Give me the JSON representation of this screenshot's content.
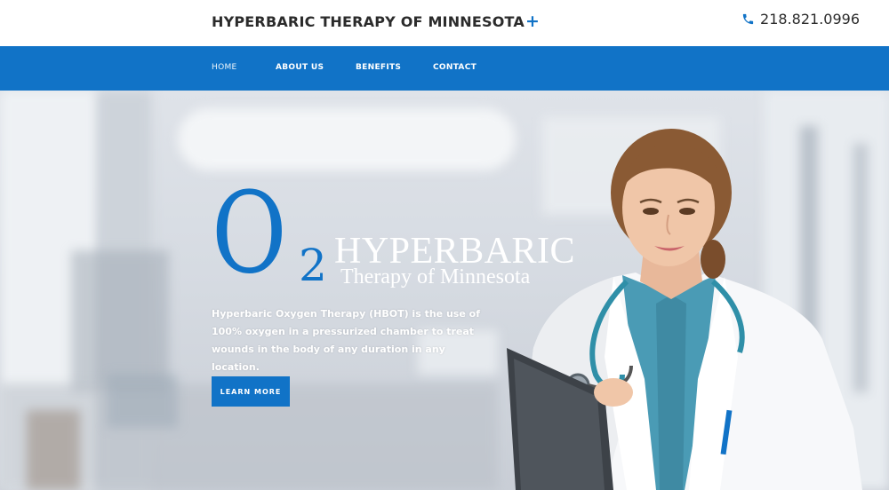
{
  "header": {
    "site_title": "HYPERBARIC THERAPY OF MINNESOTA",
    "title_plus": "+",
    "phone": "218.821.0996",
    "phone_icon": "phone-icon"
  },
  "nav": {
    "items": [
      {
        "label": "HOME"
      },
      {
        "label": "ABOUT US"
      },
      {
        "label": "BENEFITS"
      },
      {
        "label": "CONTACT"
      }
    ]
  },
  "hero": {
    "logo": {
      "o": "O",
      "two": "2",
      "line1": "HYPERBARIC",
      "line2": "Therapy of Minnesota"
    },
    "description": "Hyperbaric Oxygen Therapy (HBOT) is the use of 100% oxygen in a pressurized chamber to treat wounds in the body of any duration in any location.",
    "cta_label": "LEARN MORE"
  },
  "colors": {
    "brand_blue": "#1173c7",
    "text_dark": "#2b2b2b",
    "white": "#ffffff"
  }
}
